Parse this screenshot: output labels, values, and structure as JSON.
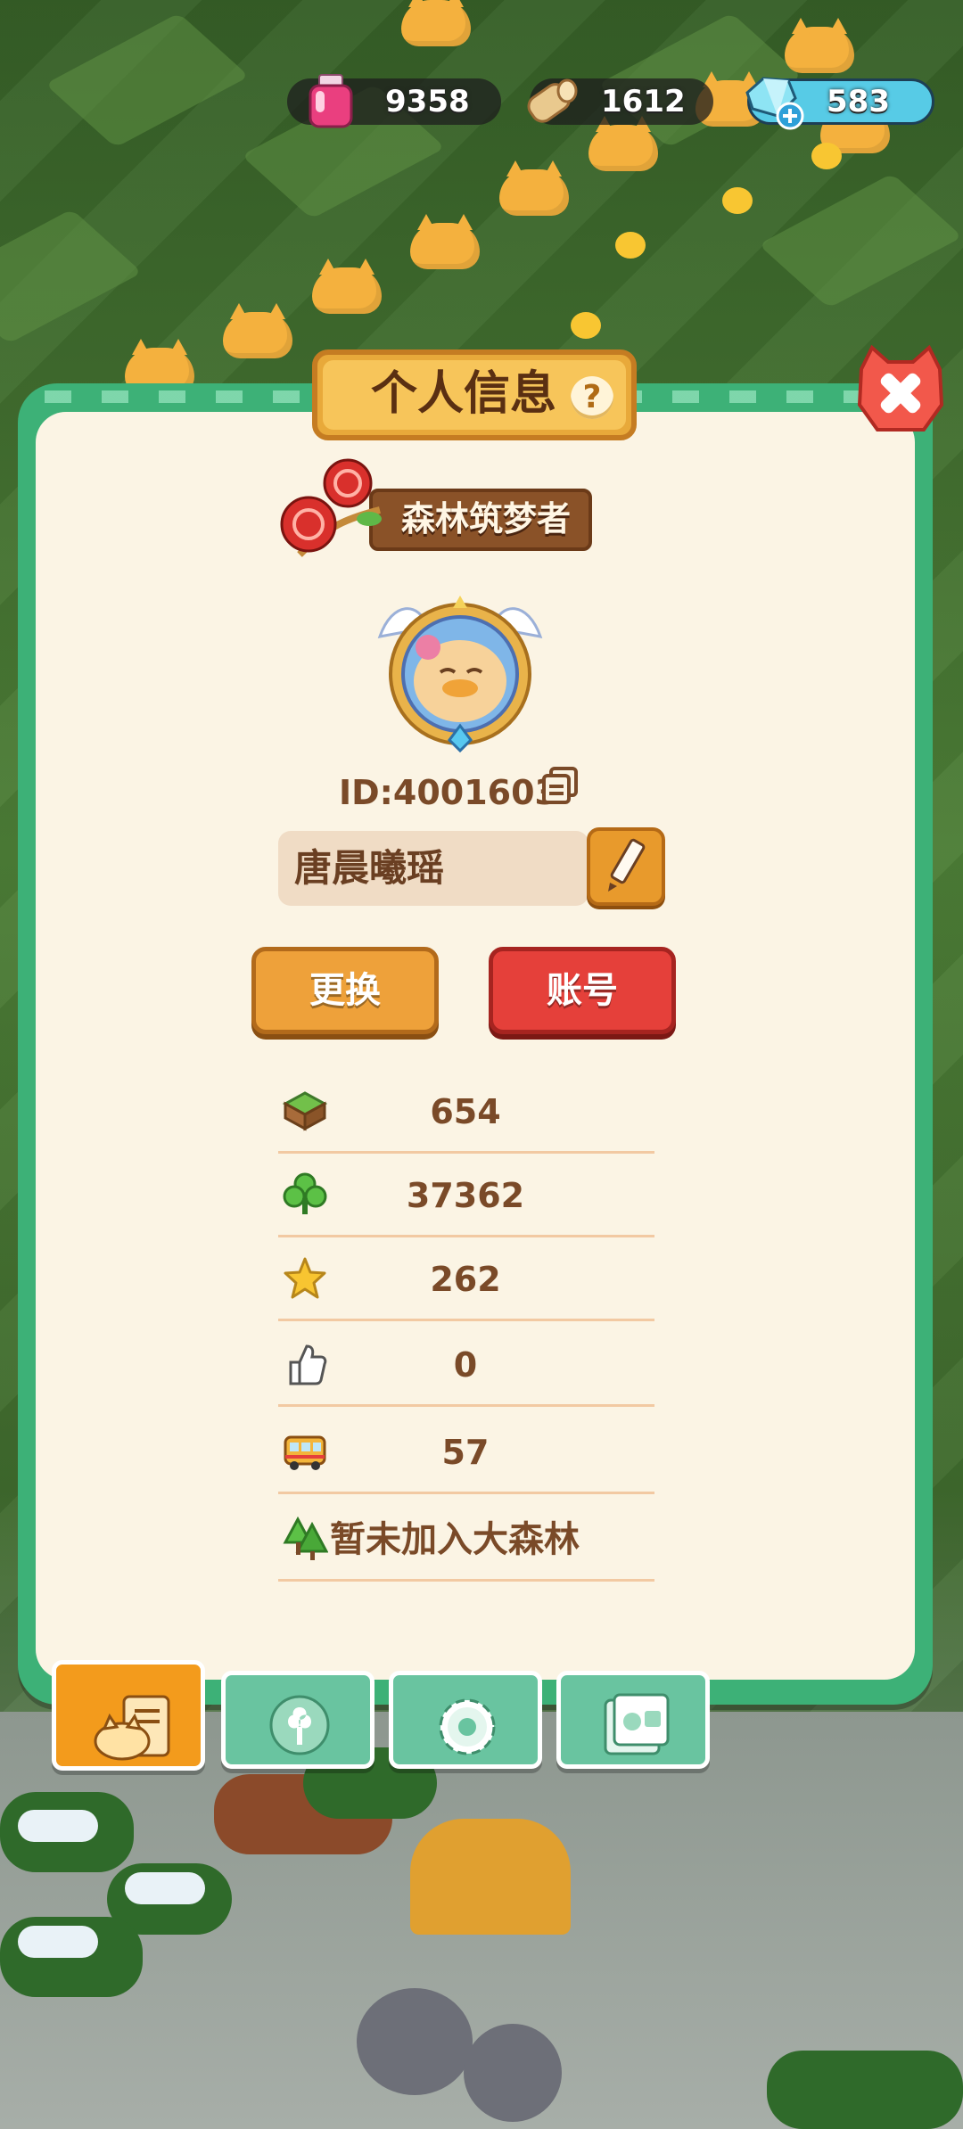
{
  "resources": {
    "potion": {
      "value": "9358",
      "icon": "pink-potion-icon"
    },
    "wood": {
      "value": "1612",
      "icon": "wood-log-icon"
    },
    "gems": {
      "value": "583",
      "icon": "blue-gem-plus-icon"
    }
  },
  "panel": {
    "title": "个人信息",
    "rank_badge": "森林筑梦者",
    "player_id": "ID:4001603",
    "name": "唐晨曦瑶",
    "buttons": {
      "change": "更换",
      "account": "账号"
    },
    "stats": [
      {
        "icon": "land-block-icon",
        "value": "654"
      },
      {
        "icon": "clover-icon",
        "value": "37362"
      },
      {
        "icon": "star-icon",
        "value": "262"
      },
      {
        "icon": "thumbs-up-icon",
        "value": "0"
      },
      {
        "icon": "bus-icon",
        "value": "57"
      }
    ],
    "forest_status": "暂未加入大森林"
  },
  "tabs": [
    {
      "name": "profile-tab",
      "icon": "cat-note-icon",
      "active": true
    },
    {
      "name": "badge-tab",
      "icon": "flower-badge-icon",
      "active": false
    },
    {
      "name": "settings-tab",
      "icon": "gear-icon",
      "active": false
    },
    {
      "name": "album-tab",
      "icon": "photo-album-icon",
      "active": false
    }
  ],
  "colors": {
    "panel_green": "#3db177",
    "panel_bg": "#fbf4e4",
    "text_brown": "#7a4a28",
    "account_red": "#e5403a",
    "change_orange": "#eea13a"
  }
}
